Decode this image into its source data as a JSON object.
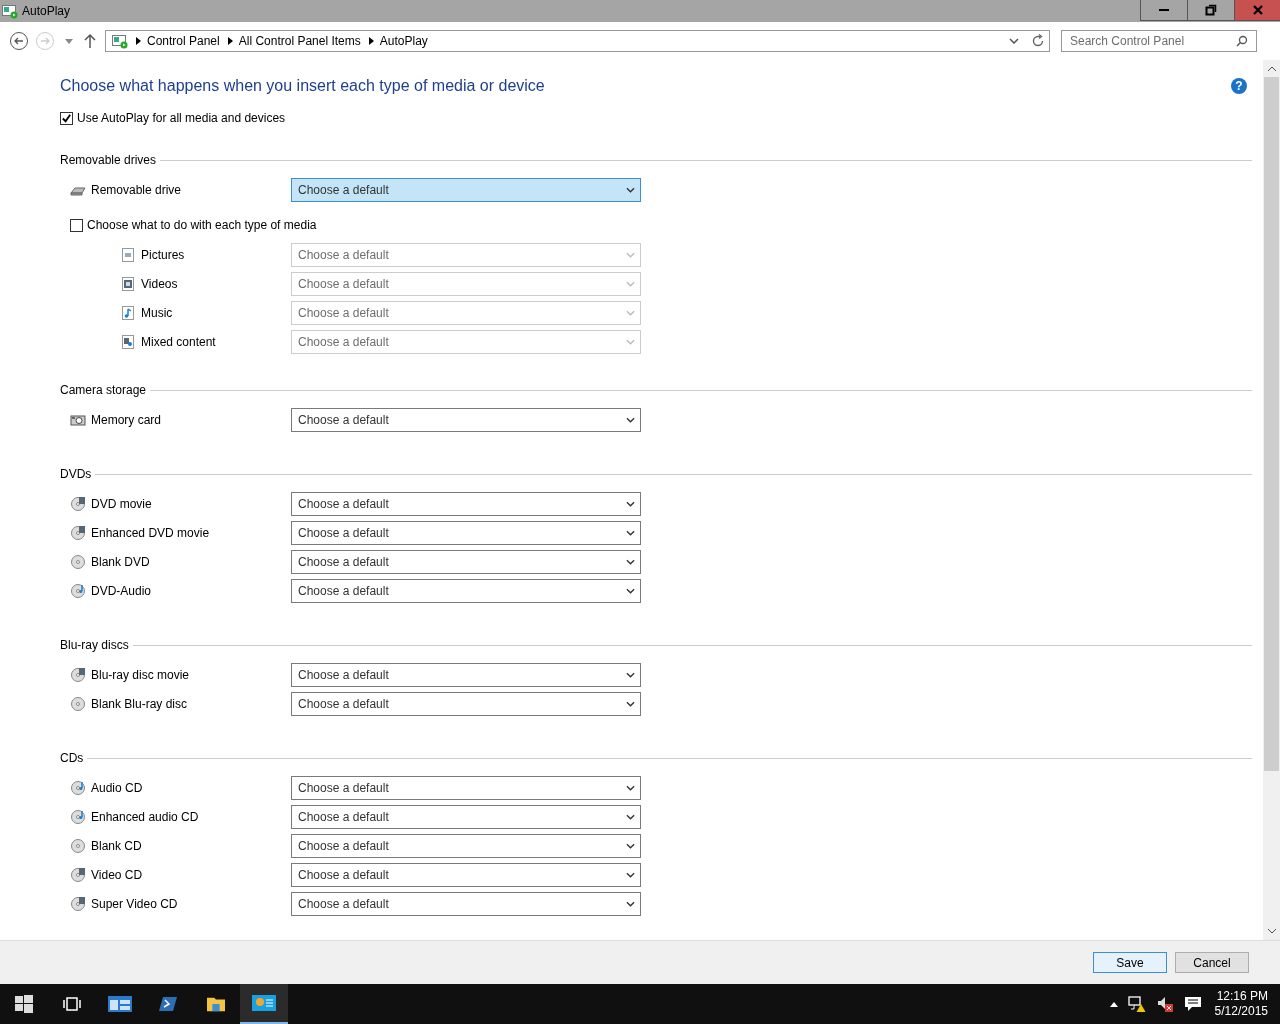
{
  "window": {
    "title": "AutoPlay"
  },
  "address": {
    "crumbs": [
      "Control Panel",
      "All Control Panel Items",
      "AutoPlay"
    ],
    "search_placeholder": "Search Control Panel"
  },
  "heading": "Choose what happens when you insert each type of media or device",
  "help_button": "?",
  "autoplay_option": {
    "label": "Use AutoPlay for all media and devices",
    "checked": true
  },
  "sections": [
    {
      "title": "Removable drives",
      "items": [
        {
          "label": "Removable drive",
          "kind": "drive",
          "value": "Choose a default",
          "disabled": false,
          "focused": true
        }
      ],
      "media_option": {
        "label": "Choose what to do with each type of media",
        "checked": false,
        "items": [
          {
            "label": "Pictures",
            "kind": "picture",
            "value": "Choose a default",
            "disabled": true,
            "focused": false
          },
          {
            "label": "Videos",
            "kind": "video",
            "value": "Choose a default",
            "disabled": true,
            "focused": false
          },
          {
            "label": "Music",
            "kind": "music",
            "value": "Choose a default",
            "disabled": true,
            "focused": false
          },
          {
            "label": "Mixed content",
            "kind": "mixed",
            "value": "Choose a default",
            "disabled": true,
            "focused": false
          }
        ]
      }
    },
    {
      "title": "Camera storage",
      "items": [
        {
          "label": "Memory card",
          "kind": "camera",
          "value": "Choose a default",
          "disabled": false,
          "focused": false
        }
      ]
    },
    {
      "title": "DVDs",
      "items": [
        {
          "label": "DVD movie",
          "kind": "video-disc",
          "value": "Choose a default",
          "disabled": false,
          "focused": false
        },
        {
          "label": "Enhanced DVD movie",
          "kind": "video-disc",
          "value": "Choose a default",
          "disabled": false,
          "focused": false
        },
        {
          "label": "Blank DVD",
          "kind": "disc",
          "value": "Choose a default",
          "disabled": false,
          "focused": false
        },
        {
          "label": "DVD-Audio",
          "kind": "audio-disc",
          "value": "Choose a default",
          "disabled": false,
          "focused": false
        }
      ]
    },
    {
      "title": "Blu-ray discs",
      "items": [
        {
          "label": "Blu-ray disc movie",
          "kind": "video-disc",
          "value": "Choose a default",
          "disabled": false,
          "focused": false
        },
        {
          "label": "Blank Blu-ray disc",
          "kind": "disc",
          "value": "Choose a default",
          "disabled": false,
          "focused": false
        }
      ]
    },
    {
      "title": "CDs",
      "items": [
        {
          "label": "Audio CD",
          "kind": "audio-disc",
          "value": "Choose a default",
          "disabled": false,
          "focused": false
        },
        {
          "label": "Enhanced audio CD",
          "kind": "audio-disc",
          "value": "Choose a default",
          "disabled": false,
          "focused": false
        },
        {
          "label": "Blank CD",
          "kind": "disc",
          "value": "Choose a default",
          "disabled": false,
          "focused": false
        },
        {
          "label": "Video CD",
          "kind": "video-disc",
          "value": "Choose a default",
          "disabled": false,
          "focused": false
        },
        {
          "label": "Super Video CD",
          "kind": "video-disc",
          "value": "Choose a default",
          "disabled": false,
          "focused": false
        }
      ]
    }
  ],
  "buttons": [
    {
      "label": "Save",
      "default": true
    },
    {
      "label": "Cancel",
      "default": false
    }
  ],
  "taskbar": {
    "apps": [
      {
        "kind": "start",
        "selected": false
      },
      {
        "kind": "task-view",
        "selected": false
      },
      {
        "kind": "server-manager",
        "selected": false
      },
      {
        "kind": "powershell",
        "selected": false
      },
      {
        "kind": "file-explorer",
        "selected": false
      },
      {
        "kind": "control-panel",
        "selected": true
      }
    ],
    "time": "12:16 PM",
    "date": "5/12/2015"
  }
}
